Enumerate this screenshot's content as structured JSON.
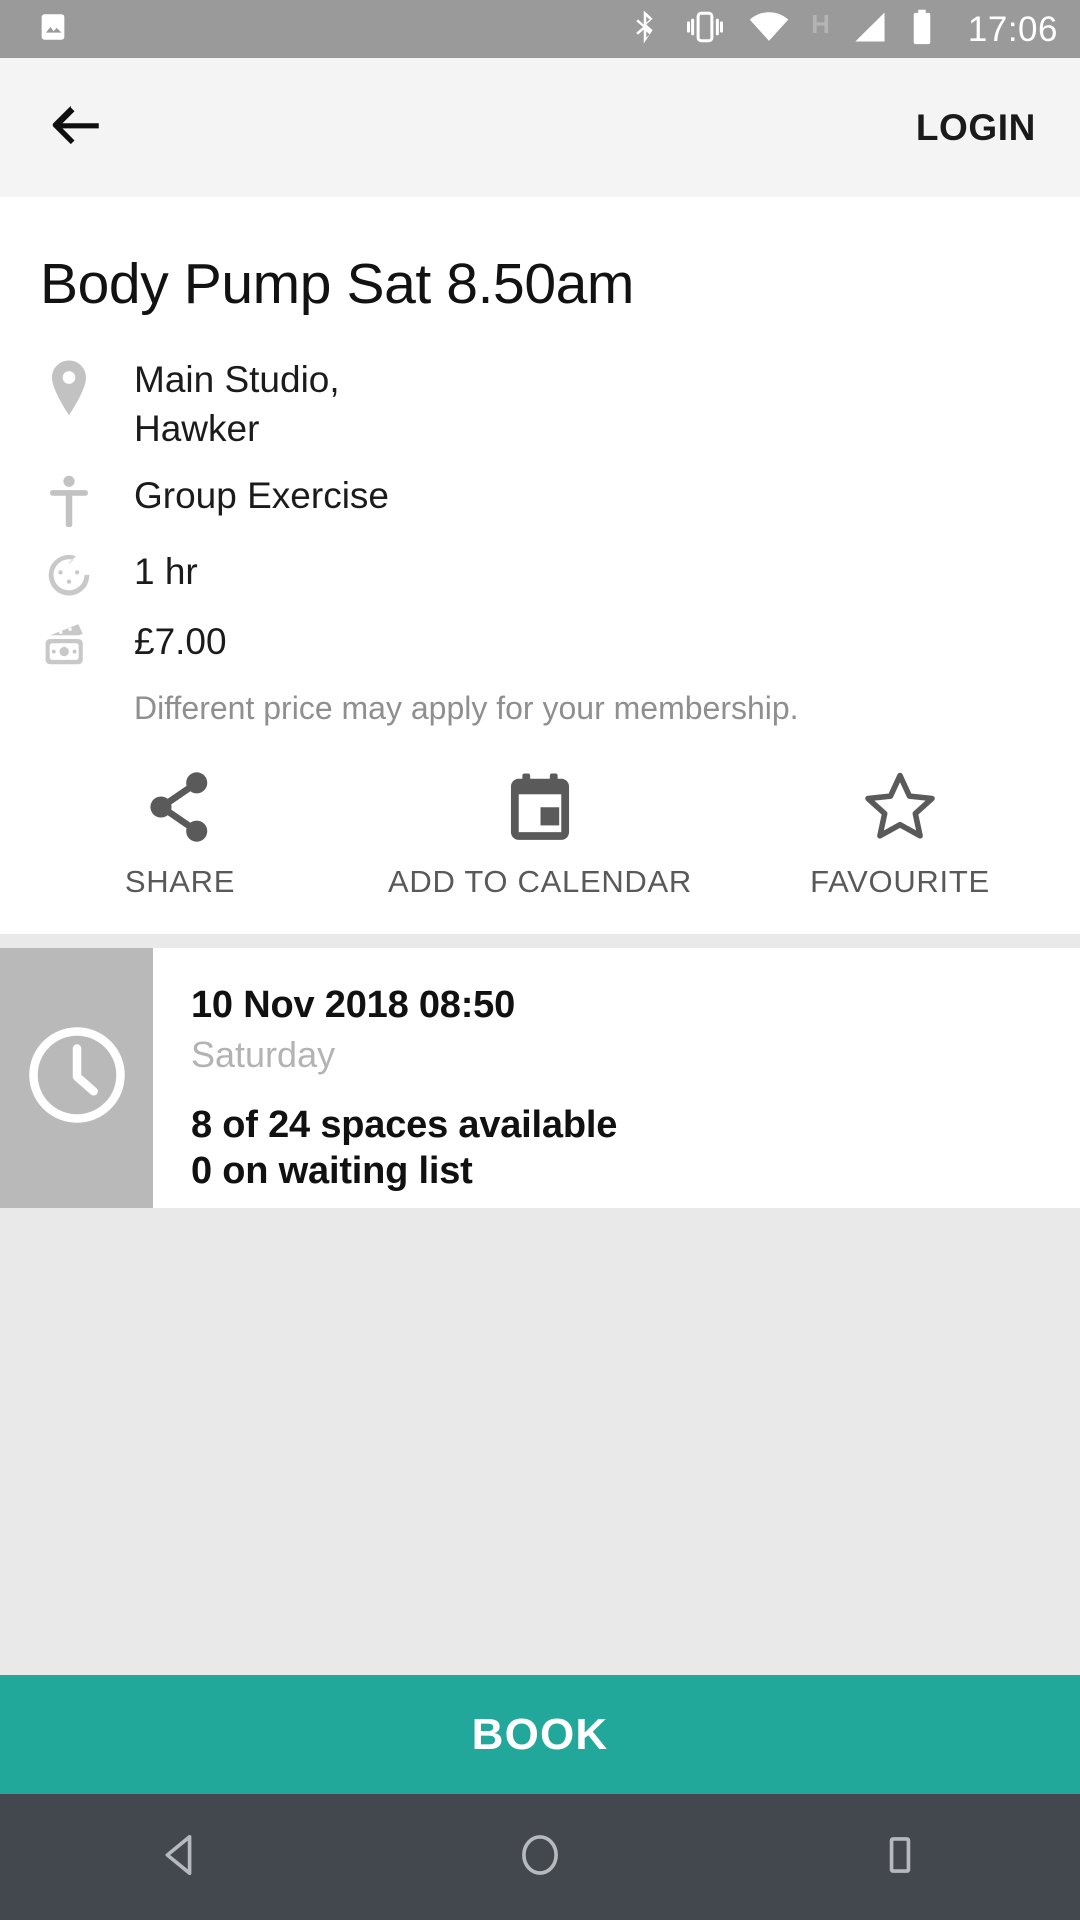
{
  "status_bar": {
    "time": "17:06",
    "network_type": "H",
    "icons": [
      "image-icon",
      "bluetooth-icon",
      "vibrate-icon",
      "wifi-icon",
      "cellular-signal-icon",
      "battery-icon"
    ],
    "background_color": "#9a9a9a"
  },
  "app_bar": {
    "back_icon": "back-arrow-icon",
    "login_label": "LOGIN",
    "background_color": "#f4f4f4"
  },
  "class_detail": {
    "title": "Body Pump Sat 8.50am",
    "info_rows": [
      {
        "icon": "location-pin-icon",
        "text": "Main Studio,\nHawker"
      },
      {
        "icon": "accessibility-person-icon",
        "text": "Group Exercise"
      },
      {
        "icon": "timer-icon",
        "text": "1 hr"
      },
      {
        "icon": "money-banknote-icon",
        "text": "£7.00"
      }
    ],
    "price_note": "Different price may apply for your membership."
  },
  "actions": [
    {
      "icon": "share-icon",
      "label": "SHARE"
    },
    {
      "icon": "calendar-icon",
      "label": "ADD TO CALENDAR"
    },
    {
      "icon": "star-outline-icon",
      "label": "FAVOURITE"
    }
  ],
  "session": {
    "thumb_icon": "clock-icon",
    "datetime": "10 Nov 2018 08:50",
    "day": "Saturday",
    "spaces": "8 of 24 spaces available",
    "waiting": "0 on waiting list"
  },
  "book": {
    "label": "BOOK",
    "accent_color": "#22a79b"
  },
  "nav_bar": {
    "background_color": "#43484e",
    "buttons": [
      "back-triangle-icon",
      "home-circle-icon",
      "recents-square-icon"
    ]
  }
}
